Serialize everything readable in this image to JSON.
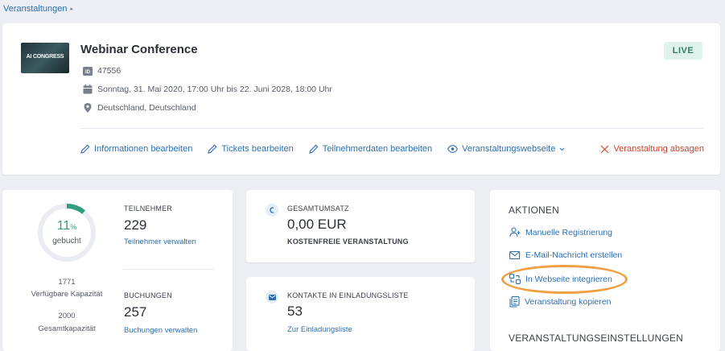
{
  "breadcrumb": {
    "label": "Veranstaltungen"
  },
  "event": {
    "thumbnail_text": "AI CONGRESS",
    "title": "Webinar Conference",
    "id_badge": "ID",
    "id": "47556",
    "date": "Sonntag, 31. Mai 2020, 17:00 Uhr bis 22. Juni 2028, 18:00 Uhr",
    "location": "Deutschland, Deutschland",
    "status": "LIVE",
    "status_color": "#2f7d63"
  },
  "event_actions": {
    "edit_info": "Informationen bearbeiten",
    "edit_tickets": "Tickets bearbeiten",
    "edit_attendee_data": "Teilnehmerdaten bearbeiten",
    "event_website": "Veranstaltungswebseite",
    "cancel_event": "Veranstaltung absagen"
  },
  "stats": {
    "booked_percent": "11",
    "booked_fraction": 0.11,
    "percent_sign": "%",
    "booked_label": "gebucht",
    "available_capacity": "1771",
    "available_capacity_label": "Verfügbare Kapazität",
    "total_capacity": "2000",
    "total_capacity_label": "Gesamtkapazität",
    "attendees_head": "TEILNEHMER",
    "attendees_count": "229",
    "attendees_link": "Teilnehmer verwalten",
    "bookings_head": "BUCHUNGEN",
    "bookings_count": "257",
    "bookings_link": "Buchungen verwalten",
    "accent_color": "#2f9f7d"
  },
  "revenue": {
    "head": "GESAMTUMSATZ",
    "amount": "0,00 EUR",
    "note": "KOSTENFREIE VERANSTALTUNG"
  },
  "invitations": {
    "head": "KONTAKTE IN EINLADUNGSLISTE",
    "count": "53",
    "link": "Zur Einladungsliste"
  },
  "actions_panel": {
    "head": "AKTIONEN",
    "items": [
      {
        "label": "Manuelle Registrierung",
        "icon": "user-plus-icon"
      },
      {
        "label": "E-Mail-Nachricht erstellen",
        "icon": "mail-icon"
      },
      {
        "label": "In Webseite integrieren",
        "icon": "embed-icon"
      },
      {
        "label": "Veranstaltung kopieren",
        "icon": "copy-icon"
      }
    ],
    "settings_head": "VERANSTALTUNGSEINSTELLUNGEN",
    "highlight_color": "#f0a043"
  }
}
